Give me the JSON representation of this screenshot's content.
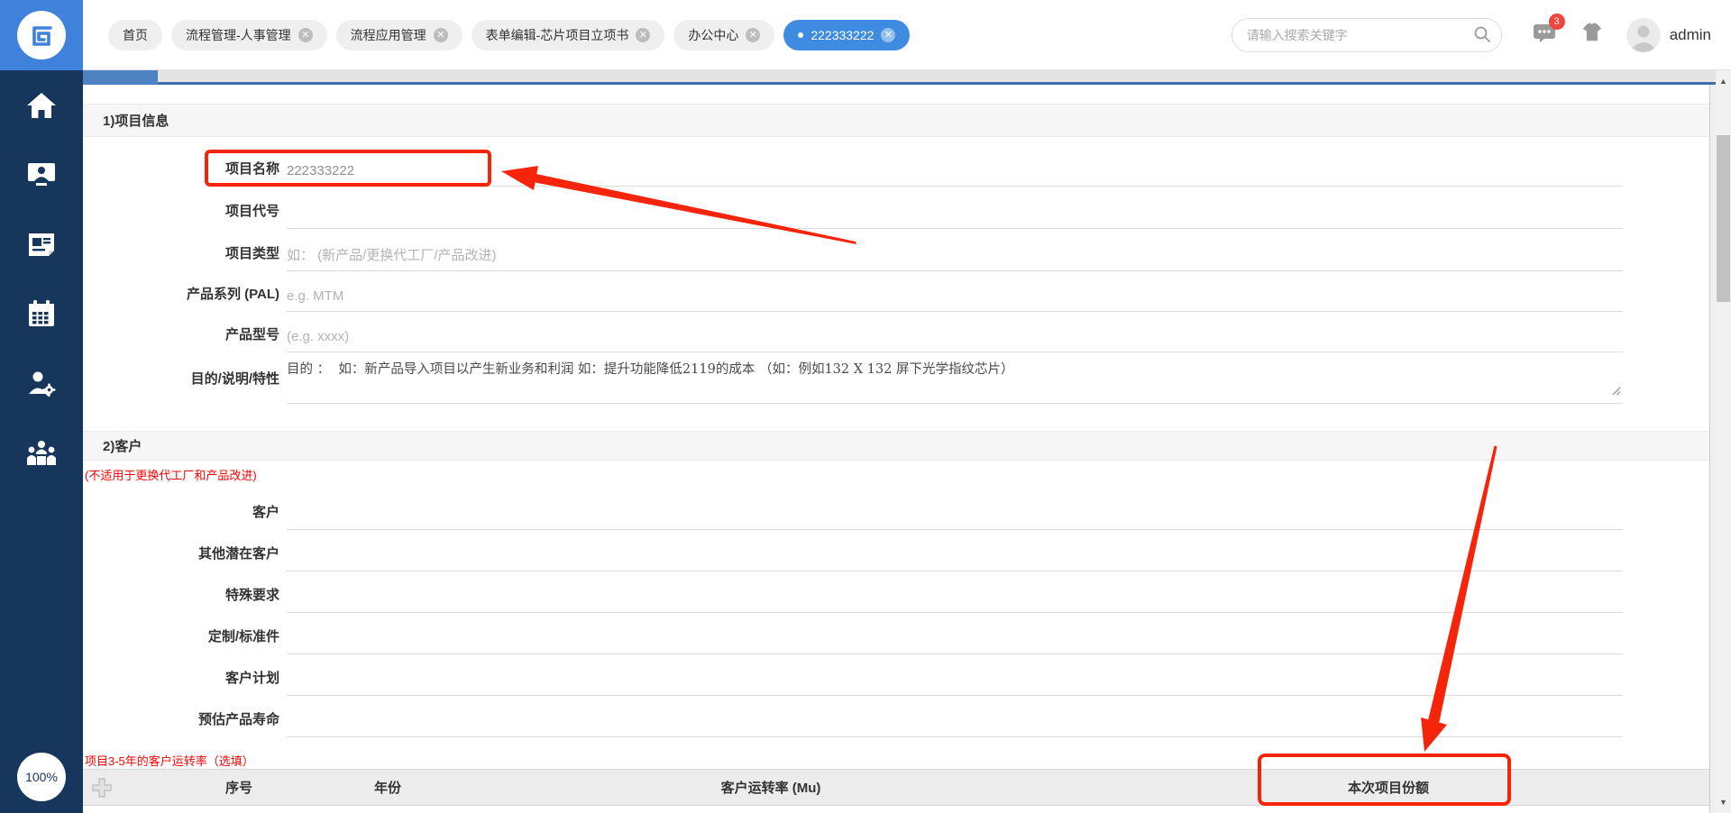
{
  "header": {
    "tabs": [
      {
        "label": "首页"
      },
      {
        "label": "流程管理-人事管理"
      },
      {
        "label": "流程应用管理"
      },
      {
        "label": "表单编辑-芯片项目立项书"
      },
      {
        "label": "办公中心"
      },
      {
        "label": "222333222"
      }
    ],
    "search": {
      "placeholder": "请输入搜索关键字"
    },
    "message_badge": "3",
    "username": "admin"
  },
  "sidebar": {
    "zoom_level": "100%"
  },
  "form": {
    "sections": {
      "s1_title": "1)项目信息",
      "s2_title": "2)客户",
      "s2_note": "(不适用于更换代工厂和产品改进)",
      "table_note": "项目3-5年的客户运转率（选填）"
    },
    "fields1": [
      {
        "label": "项目名称",
        "value": "222333222",
        "placeholder": ""
      },
      {
        "label": "项目代号",
        "value": "",
        "placeholder": ""
      },
      {
        "label": "项目类型",
        "value": "",
        "placeholder": "如： (新产品/更换代工厂/产品改进)"
      },
      {
        "label": "产品系列 (PAL)",
        "value": "",
        "placeholder": "e.g. MTM"
      },
      {
        "label": "产品型号",
        "value": "",
        "placeholder": "(e.g. xxxx)"
      }
    ],
    "purpose": {
      "label": "目的/说明/特性",
      "text": "目的 ：  如：新产品导入项目以产生新业务和利润 如：提升功能降低2119的成本 （如：例如132 X 132 屏下光学指纹芯片）"
    },
    "fields2": [
      {
        "label": "客户"
      },
      {
        "label": "其他潜在客户"
      },
      {
        "label": "特殊要求"
      },
      {
        "label": "定制/标准件"
      },
      {
        "label": "客户计划"
      },
      {
        "label": "预估产品寿命"
      }
    ],
    "table": {
      "headers": [
        "序号",
        "年份",
        "客户运转率 (Mu)",
        "本次项目份额"
      ]
    }
  },
  "colors": {
    "accent_blue": "#3f8be2",
    "sidebar_navy": "#17365c",
    "annotation_red": "#f5250c",
    "note_red": "#ff0000",
    "badge_red": "#f0453c"
  }
}
